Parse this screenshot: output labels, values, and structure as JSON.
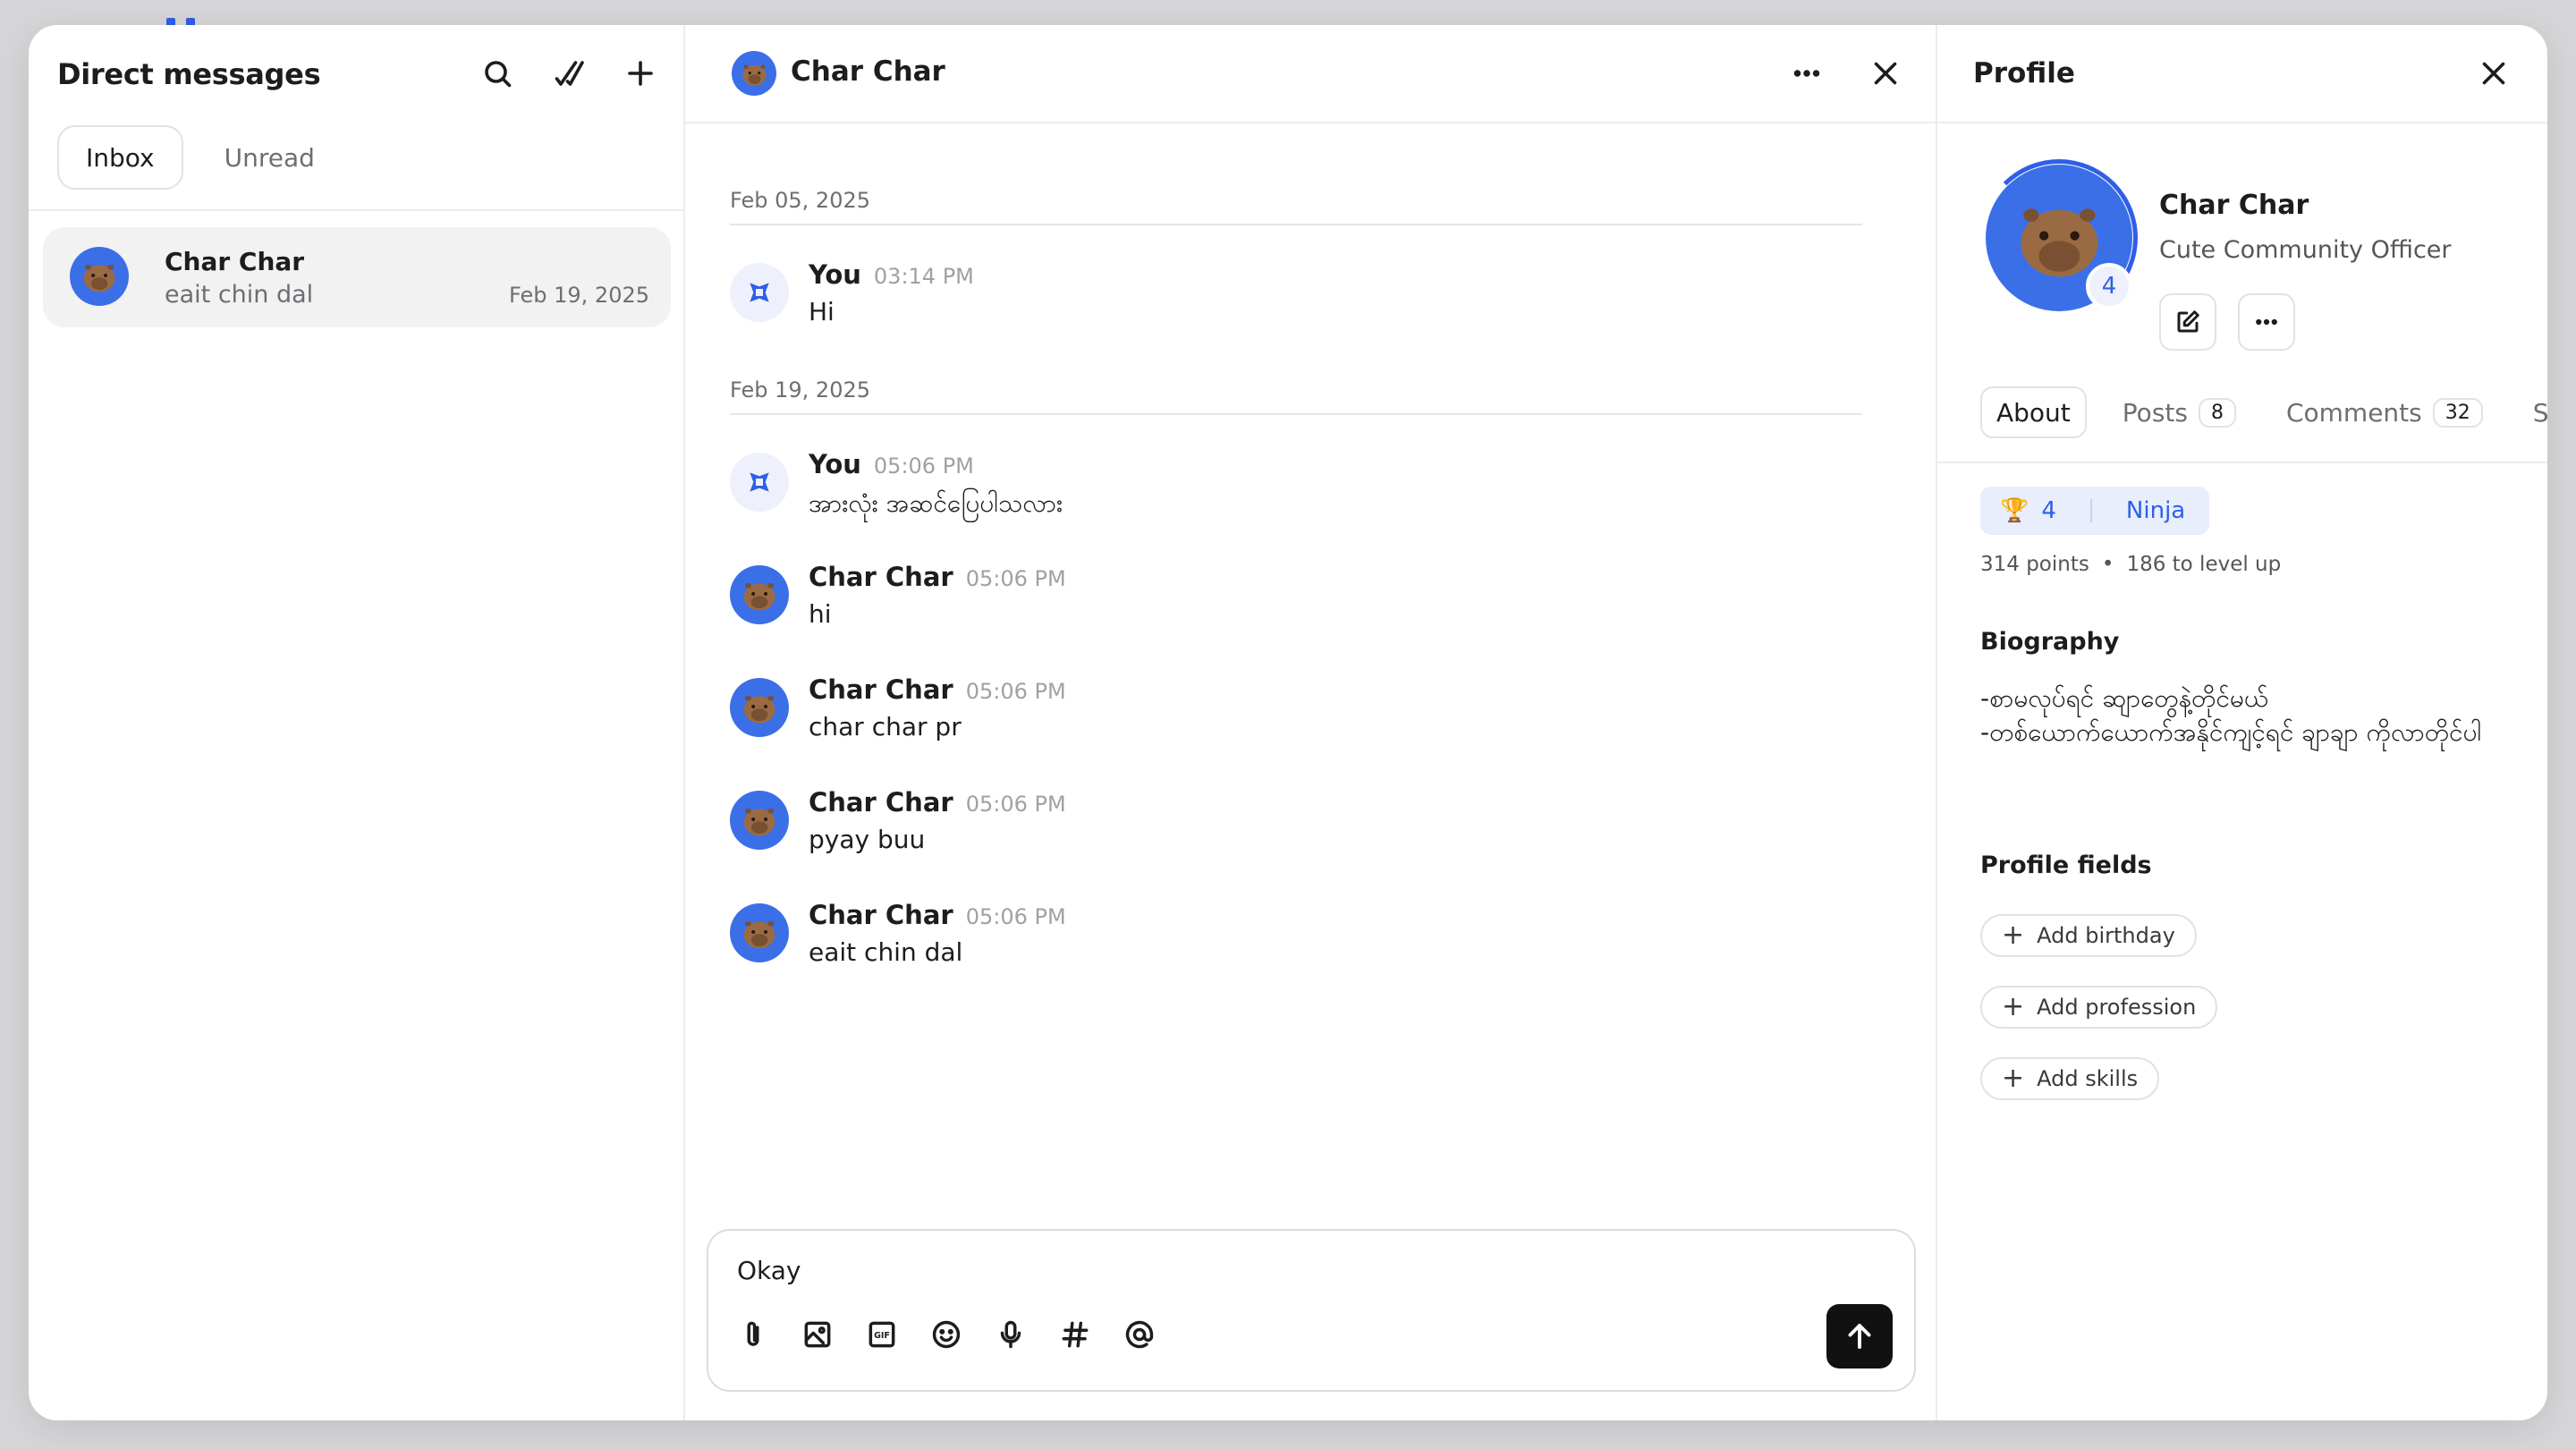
{
  "dm": {
    "title": "Direct messages",
    "tabs": [
      "Inbox",
      "Unread"
    ],
    "conversations": [
      {
        "name": "Char Char",
        "preview": "eait chin dal",
        "date": "Feb 19, 2025"
      }
    ]
  },
  "chat": {
    "title": "Char Char",
    "groups": [
      {
        "date": "Feb 05, 2025"
      },
      {
        "date": "Feb 19, 2025"
      }
    ],
    "messages": [
      {
        "author": "You",
        "time": "03:14 PM",
        "text": "Hi"
      },
      {
        "author": "You",
        "time": "05:06 PM",
        "text": "အားလုံး အဆင်ပြေပါသလား"
      },
      {
        "author": "Char Char",
        "time": "05:06 PM",
        "text": "hi"
      },
      {
        "author": "Char Char",
        "time": "05:06 PM",
        "text": "char char pr"
      },
      {
        "author": "Char Char",
        "time": "05:06 PM",
        "text": "pyay buu"
      },
      {
        "author": "Char Char",
        "time": "05:06 PM",
        "text": "eait chin dal"
      }
    ],
    "composer": {
      "value": "Okay"
    }
  },
  "profile": {
    "title": "Profile",
    "name": "Char Char",
    "role": "Cute Community Officer",
    "level": "4",
    "tabs": {
      "about": "About",
      "posts": "Posts",
      "posts_count": "8",
      "comments": "Comments",
      "comments_count": "32",
      "spaces": "Spa"
    },
    "rank": {
      "level": "4",
      "title": "Ninja"
    },
    "points": "314 points",
    "to_level_up": "186 to level up",
    "biography_title": "Biography",
    "biography": "-စာမလုပ်ရင် ဆျာတွေနဲ့တိုင်မယ်\n-တစ်ယောက်ယောက်အနိုင်ကျင့်ရင် ချာချာ ကိုလာတိုင်ပါ",
    "fields_title": "Profile fields",
    "fields": [
      "Add birthday",
      "Add profession",
      "Add skills"
    ]
  },
  "colors": {
    "accent": "#2f5ee8",
    "avatar_bg": "#3b6fe8",
    "send": "#111111"
  }
}
